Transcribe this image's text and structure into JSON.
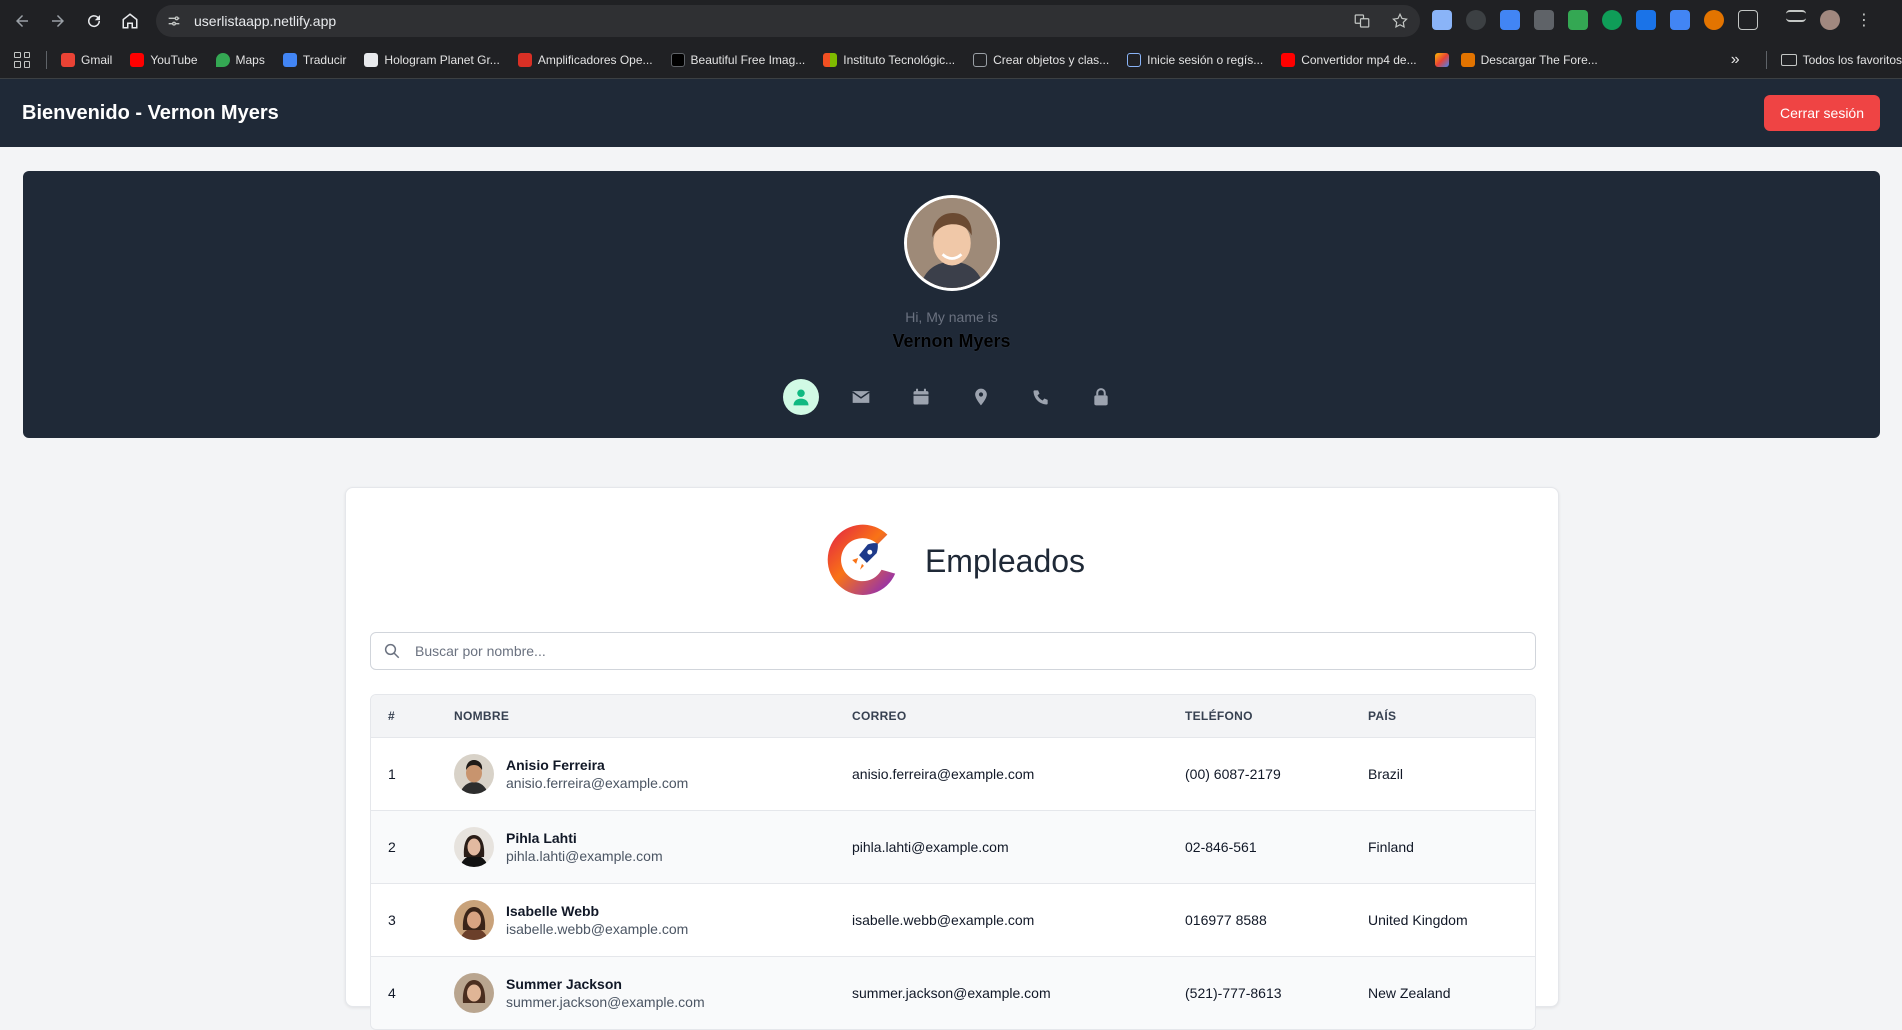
{
  "browser": {
    "url": "userlistaapp.netlify.app",
    "bookmarks": [
      {
        "label": "Gmail",
        "color": "#ea4335"
      },
      {
        "label": "YouTube",
        "color": "#ff0000"
      },
      {
        "label": "Maps",
        "color": "#34a853"
      },
      {
        "label": "Traducir",
        "color": "#4285f4"
      },
      {
        "label": "Hologram Planet Gr...",
        "color": "#e8eaed"
      },
      {
        "label": "Amplificadores Ope...",
        "color": "#d93025"
      },
      {
        "label": "Beautiful Free Imag...",
        "color": "#000000"
      },
      {
        "label": "Instituto Tecnológic...",
        "color": "#f4b400"
      },
      {
        "label": "Crear objetos y clas...",
        "color": "#9aa0a6"
      },
      {
        "label": "Inicie sesión o regís...",
        "color": "#8ab4f8"
      },
      {
        "label": "Convertidor mp4 de...",
        "color": "#ff0000"
      },
      {
        "label": "",
        "color": "#fbbc04"
      },
      {
        "label": "Descargar The Fore...",
        "color": "#e37400"
      }
    ],
    "more": "»",
    "all_bookmarks": "Todos los favoritos"
  },
  "header": {
    "title": "Bienvenido - Vernon Myers",
    "logout_label": "Cerrar sesión"
  },
  "profile": {
    "greeting": "Hi, My name is",
    "name": "Vernon Myers"
  },
  "employees": {
    "title": "Empleados",
    "search_placeholder": "Buscar por nombre...",
    "columns": [
      "#",
      "NOMBRE",
      "CORREO",
      "TELÉFONO",
      "PAÍS"
    ],
    "rows": [
      {
        "num": "1",
        "name": "Anisio Ferreira",
        "email": "anisio.ferreira@example.com",
        "phone": "(00) 6087-2179",
        "country": "Brazil"
      },
      {
        "num": "2",
        "name": "Pihla Lahti",
        "email": "pihla.lahti@example.com",
        "phone": "02-846-561",
        "country": "Finland"
      },
      {
        "num": "3",
        "name": "Isabelle Webb",
        "email": "isabelle.webb@example.com",
        "phone": "016977 8588",
        "country": "United Kingdom"
      },
      {
        "num": "4",
        "name": "Summer Jackson",
        "email": "summer.jackson@example.com",
        "phone": "(521)-777-8613",
        "country": "New Zealand"
      }
    ]
  },
  "colors": {
    "header_bg": "#1f2937",
    "logout_bg": "#ef4444",
    "active_icon": "#10b981"
  }
}
